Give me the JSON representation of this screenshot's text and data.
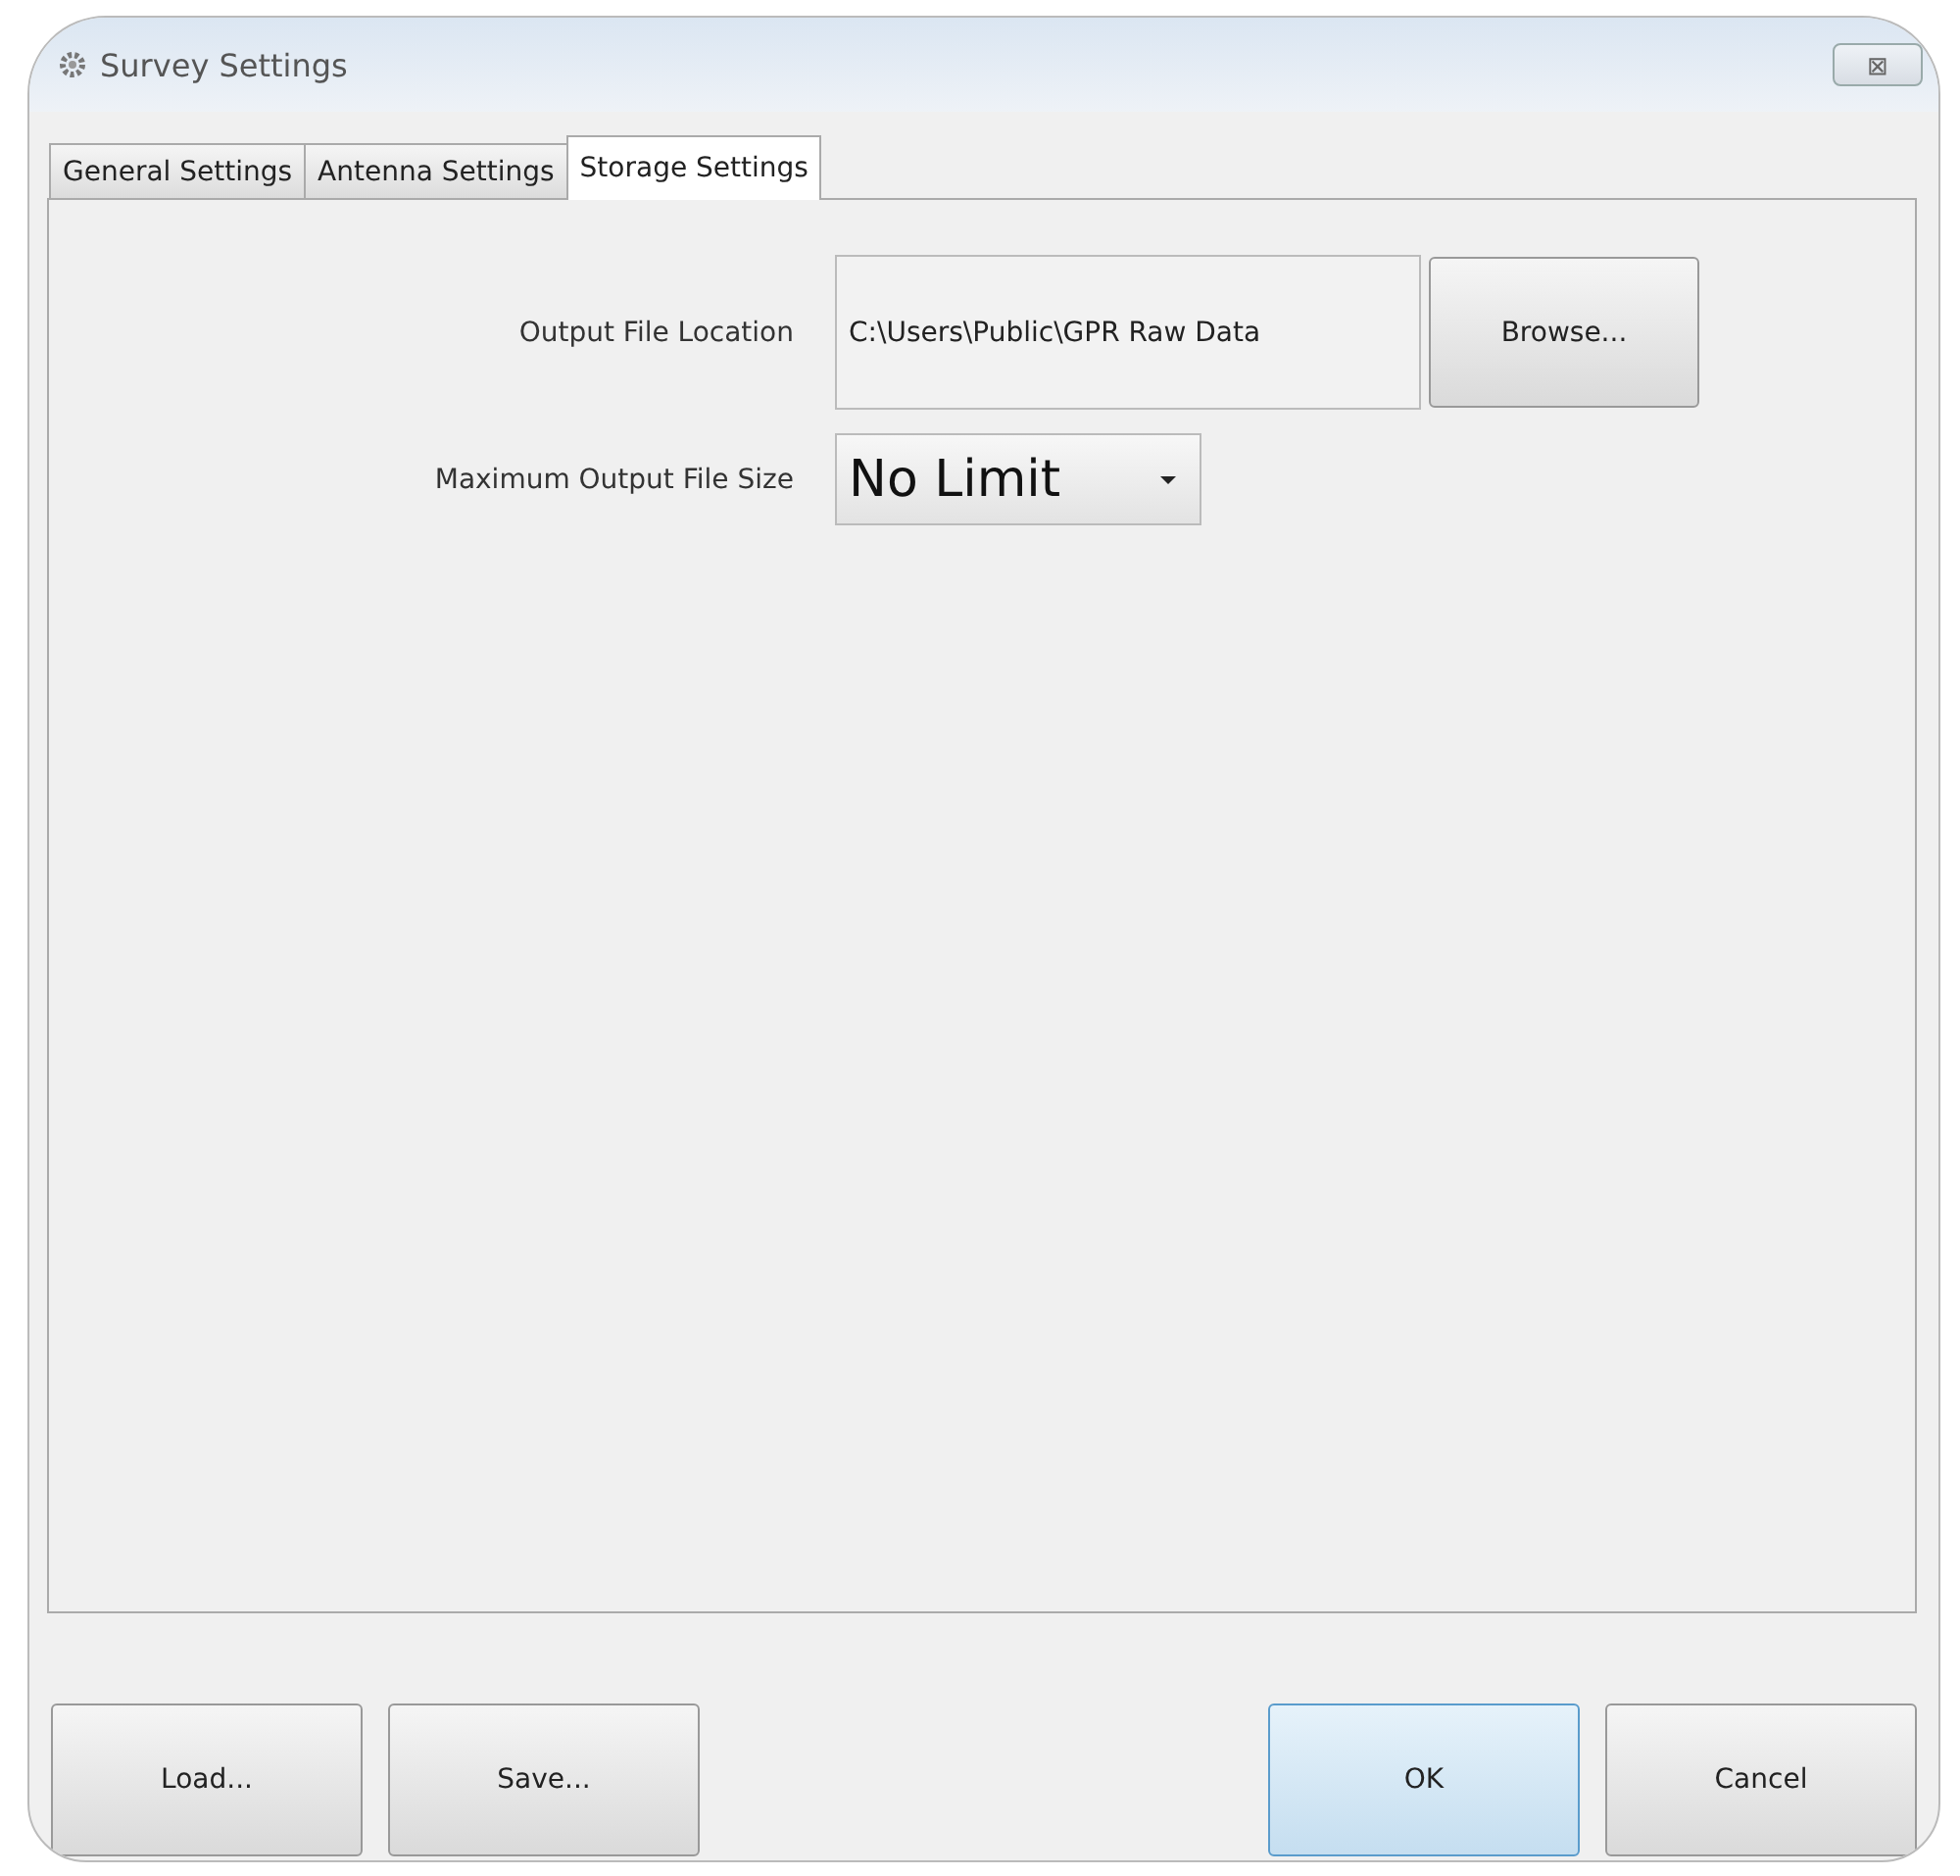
{
  "window": {
    "title": "Survey Settings",
    "close_label": "⊠"
  },
  "tabs": [
    {
      "label": "General Settings",
      "selected": false
    },
    {
      "label": "Antenna Settings",
      "selected": false
    },
    {
      "label": "Storage Settings",
      "selected": true
    }
  ],
  "output_file_location": {
    "label": "Output File Location",
    "value": "C:\\Users\\Public\\GPR Raw Data",
    "button": "Browse..."
  },
  "maximum_output_file_size": {
    "label": "Maximum Output File Size",
    "value": "No Limit"
  },
  "left_buttons": [
    {
      "label": "Load...",
      "default": false
    },
    {
      "label": "Save...",
      "default": false
    }
  ],
  "right_buttons": [
    {
      "label": "OK",
      "default": true
    },
    {
      "label": "Cancel",
      "default": false
    }
  ]
}
